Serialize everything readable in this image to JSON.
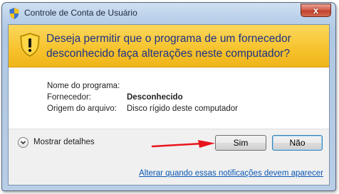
{
  "window": {
    "title": "Controle de Conta de Usuário",
    "close_glyph": "x"
  },
  "banner": {
    "icon": "uac-warning-shield-icon",
    "line1": "Deseja permitir que o programa de um fornecedor",
    "line2": "desconhecido faça alterações neste computador?"
  },
  "details": [
    {
      "label": "Nome do programa:",
      "value": ""
    },
    {
      "label": "Fornecedor:",
      "value": "Desconhecido"
    },
    {
      "label": "Origem do arquivo:",
      "value": "Disco rígido deste computador"
    }
  ],
  "actions": {
    "show_details": "Mostrar detalhes",
    "yes": "Sim",
    "no": "Não"
  },
  "footer": {
    "link": "Alterar quando essas notificações devem aparecer"
  },
  "colors": {
    "banner": "#f6c22c",
    "banner_text": "#1e3287",
    "link": "#0b58b4",
    "arrow": "#e8141b",
    "close": "#c0412c"
  }
}
